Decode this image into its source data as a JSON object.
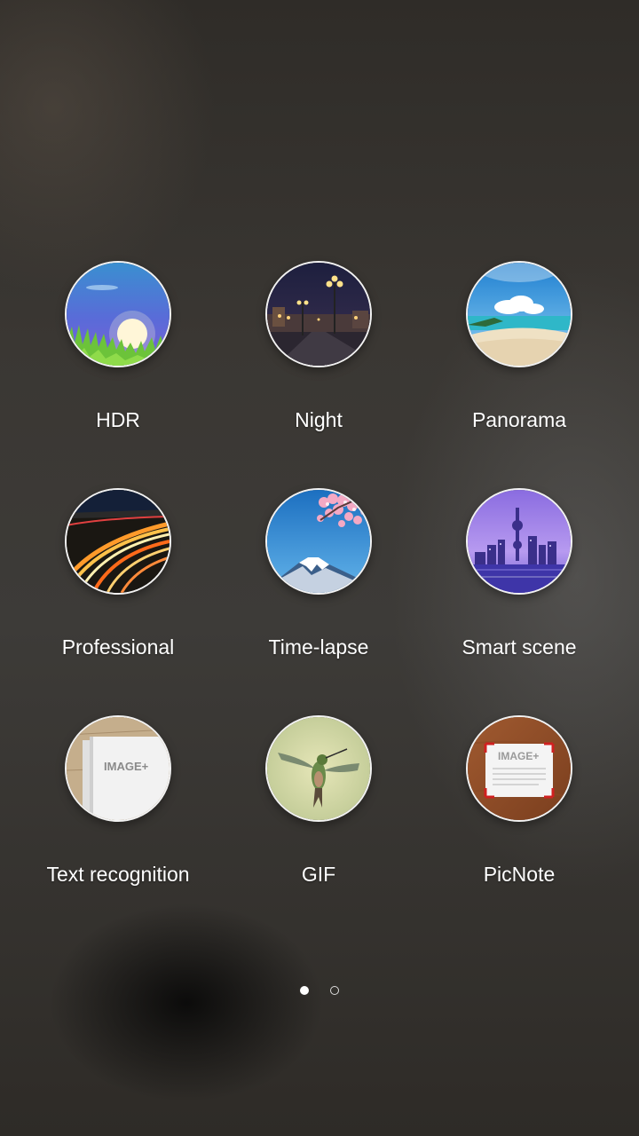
{
  "modes": [
    {
      "label": "HDR",
      "icon": "hdr-sunrise-icon"
    },
    {
      "label": "Night",
      "icon": "night-streetlights-icon"
    },
    {
      "label": "Panorama",
      "icon": "panorama-beach-icon"
    },
    {
      "label": "Professional",
      "icon": "professional-light-trails-icon"
    },
    {
      "label": "Time-lapse",
      "icon": "time-lapse-mount-fuji-icon"
    },
    {
      "label": "Smart scene",
      "icon": "smart-scene-city-icon"
    },
    {
      "label": "Text recognition",
      "icon": "text-recognition-document-icon",
      "icon_text": "IMAGE+"
    },
    {
      "label": "GIF",
      "icon": "gif-hummingbird-icon"
    },
    {
      "label": "PicNote",
      "icon": "picnote-note-icon",
      "icon_text": "IMAGE+"
    }
  ],
  "pagination": {
    "pages": 2,
    "current": 1
  },
  "colors": {
    "background": "#35322e",
    "label_text": "#ffffff",
    "icon_border": "#f2f2f2"
  }
}
